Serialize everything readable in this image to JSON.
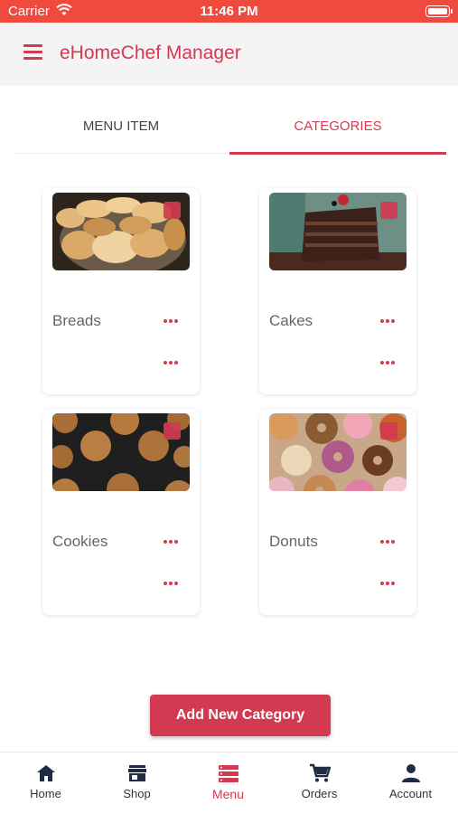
{
  "status_bar": {
    "carrier": "Carrier",
    "time": "11:46 PM"
  },
  "app_bar": {
    "title": "eHomeChef Manager"
  },
  "tabs": [
    {
      "label": "MENU ITEM",
      "active": false
    },
    {
      "label": "CATEGORIES",
      "active": true
    }
  ],
  "categories": [
    {
      "name": "Breads"
    },
    {
      "name": "Cakes"
    },
    {
      "name": "Cookies"
    },
    {
      "name": "Donuts"
    }
  ],
  "actions": {
    "add_category": "Add New Category"
  },
  "bottom_nav": [
    {
      "label": "Home",
      "icon": "home-icon"
    },
    {
      "label": "Shop",
      "icon": "shop-icon"
    },
    {
      "label": "Menu",
      "icon": "menu-list-icon",
      "active": true
    },
    {
      "label": "Orders",
      "icon": "cart-icon"
    },
    {
      "label": "Account",
      "icon": "person-icon"
    }
  ],
  "colors": {
    "accent": "#d23a51",
    "status_bar": "#f04a3f",
    "app_bar_bg": "#f4f4f4"
  }
}
